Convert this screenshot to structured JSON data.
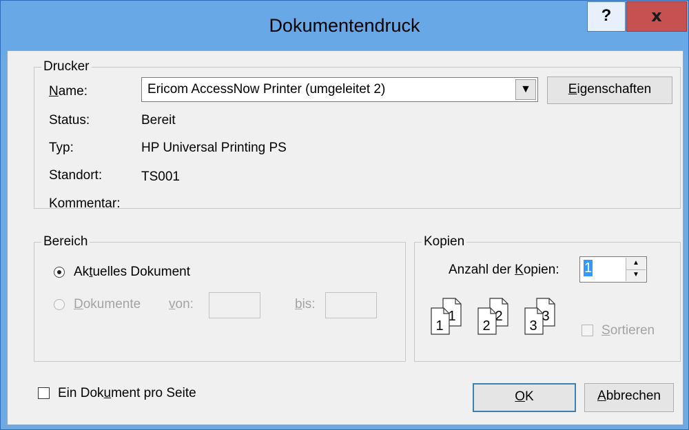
{
  "window": {
    "title": "Dokumentendruck",
    "help_glyph": "?",
    "close_glyph": "x"
  },
  "printer": {
    "legend": "Drucker",
    "name_label": "Name:",
    "name_value": "Ericom AccessNow Printer (umgeleitet 2)",
    "properties_button": "Eigenschaften",
    "status_label": "Status:",
    "status_value": "Bereit",
    "type_label": "Typ:",
    "type_value": "HP Universal Printing PS",
    "location_label": "Standort:",
    "location_value": "TS001",
    "comment_label": "Kommentar:",
    "comment_value": ""
  },
  "range": {
    "legend": "Bereich",
    "current_document_label": "Aktuelles Dokument",
    "documents_label": "Dokumente",
    "from_label": "von:",
    "from_value": "",
    "to_label": "bis:",
    "to_value": ""
  },
  "copies": {
    "legend": "Kopien",
    "count_label": "Anzahl der Kopien:",
    "count_value": "1",
    "collate_label": "Sortieren",
    "collate_icon_pages": [
      {
        "back": "1",
        "front": "1"
      },
      {
        "back": "2",
        "front": "2"
      },
      {
        "back": "3",
        "front": "3"
      }
    ]
  },
  "footer": {
    "one_per_page_label": "Ein Dokument pro Seite",
    "ok_button": "OK",
    "cancel_button": "Abbrechen"
  }
}
